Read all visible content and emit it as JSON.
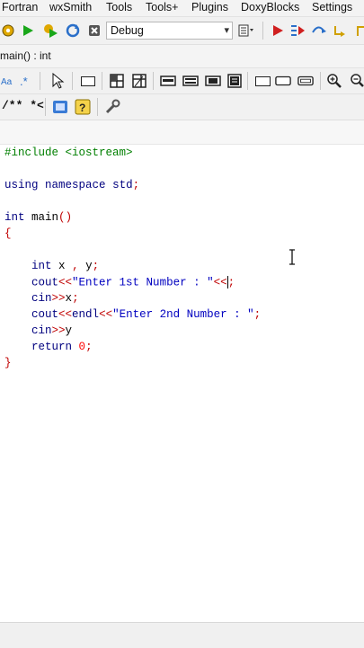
{
  "menu": {
    "items": [
      "Fortran",
      "wxSmith",
      "Tools",
      "Tools+",
      "Plugins",
      "DoxyBlocks",
      "Settings"
    ]
  },
  "toolbar": {
    "build_target": "Debug",
    "build_target_arrow": "▾"
  },
  "scope": {
    "function_text": "main() : int"
  },
  "toolbar3": {
    "doc_comment_label": "/** *<"
  },
  "editor": {
    "lines": [
      {
        "parts": [
          {
            "t": "#include <iostream>",
            "c": "pp"
          }
        ]
      },
      {
        "parts": []
      },
      {
        "parts": [
          {
            "t": "using namespace std;",
            "c": "kw"
          }
        ]
      },
      {
        "parts": []
      },
      {
        "parts": [
          {
            "t": "int ",
            "c": "kw"
          },
          {
            "t": "main()",
            "c": ""
          }
        ]
      },
      {
        "parts": [
          {
            "t": "{",
            "c": "op"
          }
        ]
      },
      {
        "parts": []
      },
      {
        "parts": [
          {
            "t": "    int x , y;",
            "c": ""
          }
        ]
      },
      {
        "parts": [
          {
            "t": "    cout<<\"Enter 1st Number : \"<<",
            "c": ""
          },
          {
            "t": ";",
            "c": ""
          }
        ]
      },
      {
        "parts": [
          {
            "t": "    cin>>x;",
            "c": ""
          }
        ]
      },
      {
        "parts": [
          {
            "t": "    cout<<endl<<\"Enter 2nd Number : \";",
            "c": ""
          }
        ]
      },
      {
        "parts": [
          {
            "t": "    cin>>y",
            "c": ""
          }
        ]
      },
      {
        "parts": [
          {
            "t": "    return 0;",
            "c": ""
          }
        ]
      },
      {
        "parts": [
          {
            "t": "}",
            "c": "op"
          }
        ]
      }
    ]
  },
  "colors": {
    "keyword": "#00007f",
    "preprocessor": "#007f00",
    "string": "#0000c0",
    "operator": "#c00000",
    "number": "#ff0000"
  }
}
